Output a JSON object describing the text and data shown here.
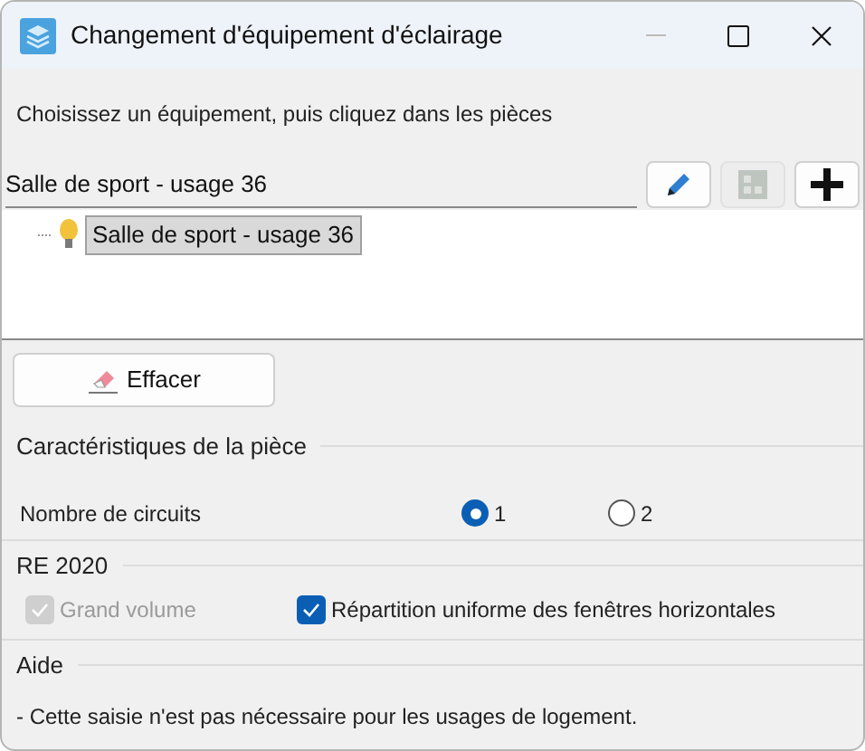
{
  "window": {
    "title": "Changement d'équipement d'éclairage"
  },
  "instruction": "Choisissez un équipement, puis cliquez dans les pièces",
  "equipment_field": {
    "value": "Salle de sport - usage 36"
  },
  "toolbar_buttons": [
    {
      "kind": "edit",
      "disabled": false
    },
    {
      "kind": "layout",
      "disabled": true
    },
    {
      "kind": "add",
      "disabled": false
    }
  ],
  "tree": [
    {
      "label": "Salle de sport - usage 36",
      "selected": true
    }
  ],
  "clear_button": {
    "label": "Effacer"
  },
  "room_section": {
    "title": "Caractéristiques de la pièce",
    "circuits_label": "Nombre de circuits",
    "circuits": [
      {
        "label": "1",
        "selected": true
      },
      {
        "label": "2",
        "selected": false
      }
    ]
  },
  "re2020_section": {
    "title": "RE 2020",
    "options": [
      {
        "label": "Grand volume",
        "checked": true,
        "disabled": true
      },
      {
        "label": "Répartition uniforme des fenêtres horizontales",
        "checked": true,
        "disabled": false
      }
    ]
  },
  "help_section": {
    "title": "Aide",
    "text": "- Cette saisie n'est pas nécessaire pour les usages de logement."
  }
}
